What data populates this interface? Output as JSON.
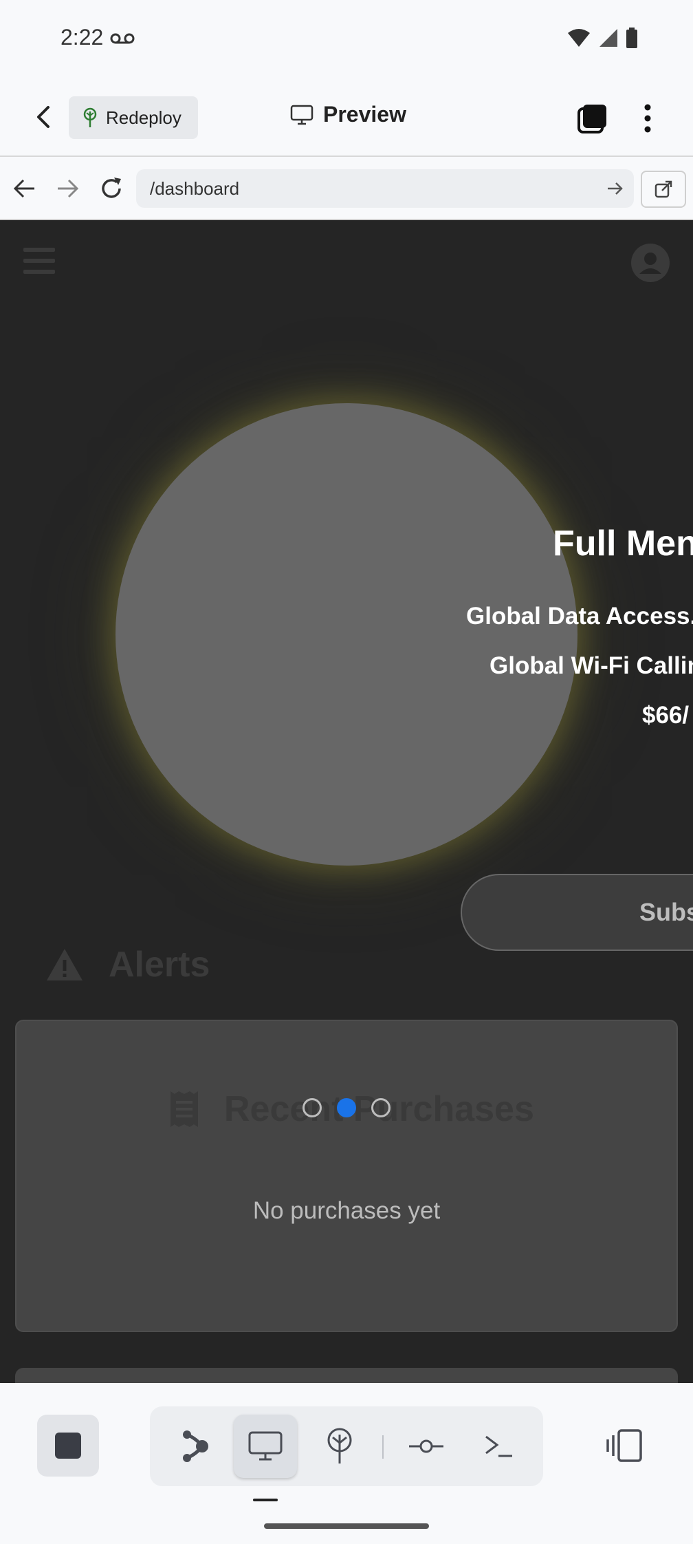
{
  "status_bar": {
    "time": "2:22"
  },
  "header": {
    "redeploy_label": "Redeploy",
    "title": "Preview"
  },
  "browser": {
    "url": "/dashboard"
  },
  "plan": {
    "title": "Full Men",
    "line1": "Global Data Access.",
    "line2": "Global Wi-Fi Callin",
    "price": "$66/",
    "subscribe_label": "Subs"
  },
  "alerts": {
    "label": "Alerts"
  },
  "purchases": {
    "title": "Recent Purchases",
    "empty_message": "No purchases yet"
  },
  "carousel": {
    "page_count": 3,
    "active_index": 1
  },
  "colors": {
    "accent": "#1a73e8",
    "viewport_bg": "#252525",
    "card_bg": "#454545"
  }
}
